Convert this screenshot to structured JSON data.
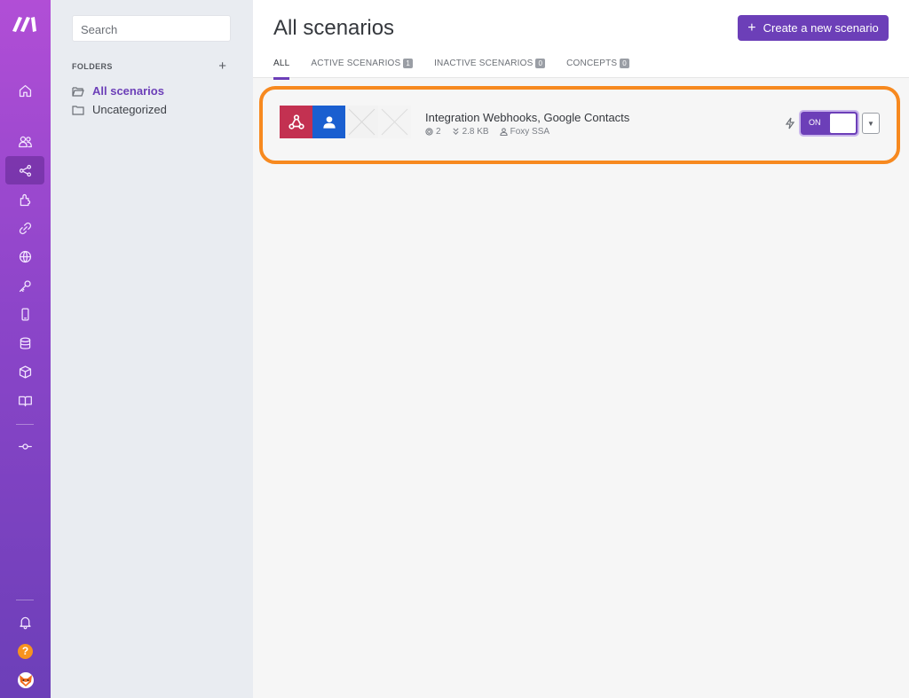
{
  "sidebar": {
    "search_placeholder": "Search",
    "folders_label": "FOLDERS",
    "add_folder": "+",
    "folders": [
      {
        "label": "All scenarios",
        "active": true
      },
      {
        "label": "Uncategorized",
        "active": false
      }
    ],
    "nav_icons": [
      "home-icon",
      "team-icon",
      "scenarios-icon",
      "apps-icon",
      "connections-icon",
      "webhooks-icon",
      "keys-icon",
      "devices-icon",
      "datastores-icon",
      "datastructures-icon",
      "docs-icon",
      "commit-icon",
      "bell-icon",
      "help-icon",
      "avatar-icon"
    ]
  },
  "header": {
    "title": "All scenarios",
    "create_label": "Create a new scenario",
    "create_plus": "+"
  },
  "tabs": [
    {
      "label": "ALL",
      "count": null,
      "active": true
    },
    {
      "label": "ACTIVE SCENARIOS",
      "count": "1",
      "active": false
    },
    {
      "label": "INACTIVE SCENARIOS",
      "count": "0",
      "active": false
    },
    {
      "label": "CONCEPTS",
      "count": "0",
      "active": false
    }
  ],
  "scenario": {
    "name": "Integration Webhooks, Google Contacts",
    "modules_count": "2",
    "size": "2.8 KB",
    "owner": "Foxy SSA",
    "toggle_label": "ON",
    "toggle_on": true
  },
  "colors": {
    "brand": "#6c3fb8",
    "highlight": "#f7891f",
    "webhook": "#c33151",
    "contacts": "#1a5fd0",
    "help": "#f7931e"
  },
  "help_badge": "?"
}
